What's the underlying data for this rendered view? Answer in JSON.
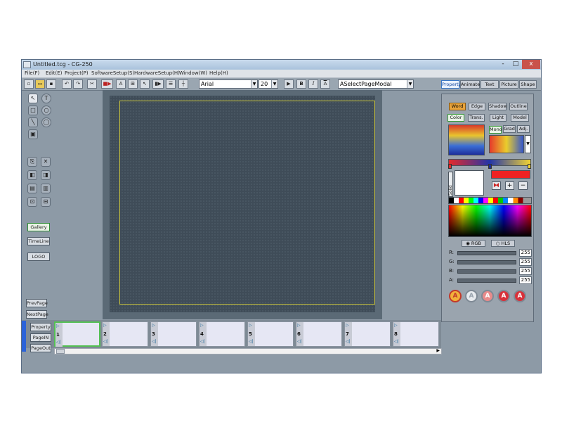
{
  "window": {
    "title": "Untitled.tcg - CG-250",
    "controls": [
      "-",
      "□",
      "x"
    ]
  },
  "menu": [
    "File(F)",
    "Edit(E)",
    "Project(P)",
    "SoftwareSetup(S)",
    "HardwareSetup(H)",
    "Window(W)",
    "Help(H)"
  ],
  "toolbar": {
    "font": "Arial",
    "size": "20",
    "bold": "B",
    "italic": "I",
    "play": "▶",
    "modal": "ASelectPageModal",
    "icons": [
      "new-icon",
      "open-icon",
      "save-icon",
      "undo-icon",
      "redo-icon",
      "cut-icon",
      "record-icon",
      "text-box-icon",
      "align-icon",
      "pointer-icon",
      "play-next-icon",
      "list-icon",
      "grid-icon"
    ],
    "anchor_label": "A"
  },
  "panel_tabs": [
    "Property",
    "Animate",
    "Text",
    "Picture",
    "Shape"
  ],
  "tools": {
    "gallery": "Gallery",
    "timeline": "TimeLine",
    "logo": "LOGO",
    "prev_page": "PrevPage",
    "next_page": "NextPage"
  },
  "timeline": {
    "buttons": [
      "Property",
      "PageIN",
      "PageOut"
    ],
    "frames": [
      "1",
      "2",
      "3",
      "4",
      "5",
      "6",
      "7",
      "8"
    ]
  },
  "right_panel": {
    "tabs_row1": [
      "Word",
      "Edge",
      "Shadow",
      "Outline"
    ],
    "tabs_row2": [
      "Color",
      "Trans.",
      "Light",
      "Model"
    ],
    "gradient_mode": [
      "Mono",
      "Grad",
      "Adj."
    ],
    "solid_label": "Solid",
    "color_modes": [
      "RGB",
      "HLS"
    ],
    "channels": [
      {
        "label": "R:",
        "value": "255"
      },
      {
        "label": "G:",
        "value": "255"
      },
      {
        "label": "B:",
        "value": "255"
      },
      {
        "label": "A:",
        "value": "255"
      }
    ],
    "style_buttons": [
      "A",
      "A",
      "A",
      "A",
      "A"
    ],
    "plus": "+",
    "minus": "−"
  },
  "colors": {
    "accent_orange": "#e8a33b",
    "frame_border": "#c8c23a",
    "selected_frame": "#53c053",
    "swatch_red": "#ee2222"
  }
}
